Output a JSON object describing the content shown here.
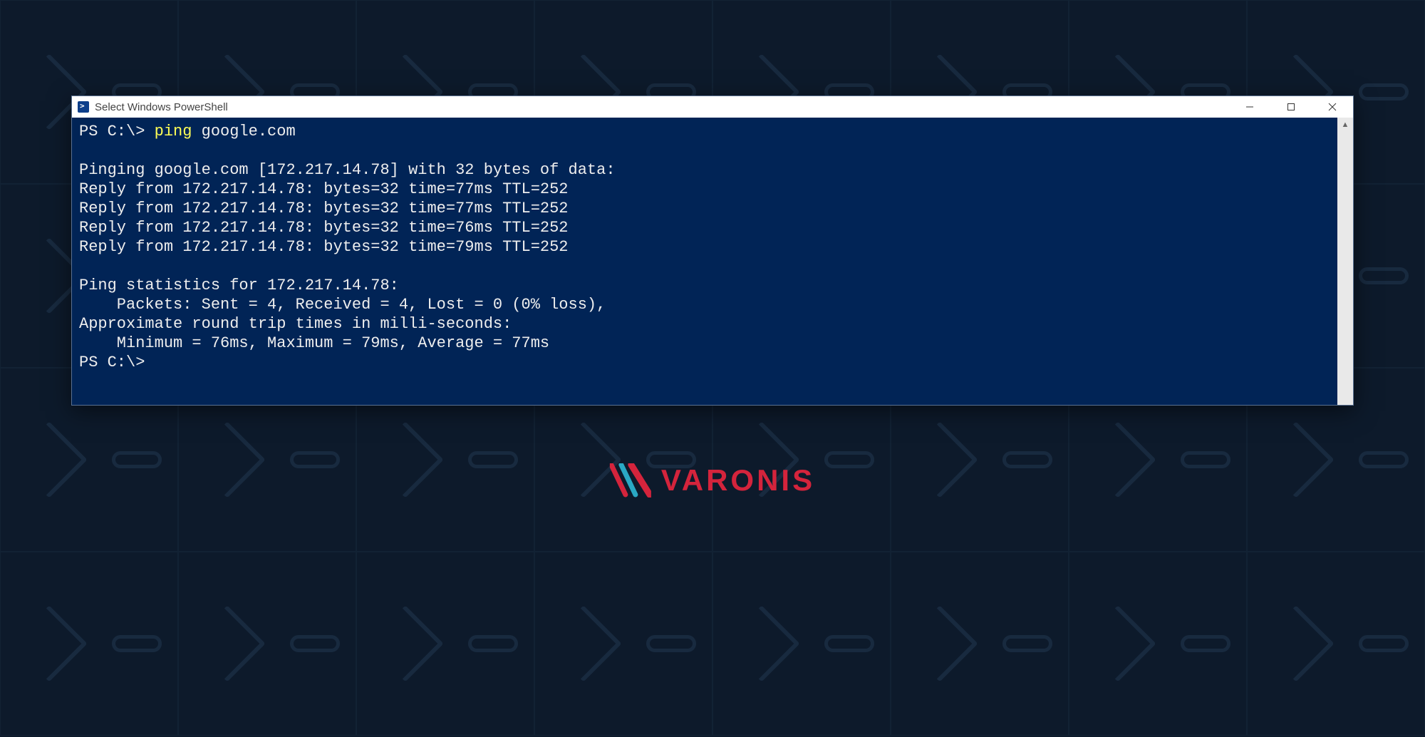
{
  "window": {
    "title": "Select Windows PowerShell"
  },
  "terminal": {
    "prompt1_prefix": "PS C:\\> ",
    "prompt1_cmd": "ping",
    "prompt1_args": " google.com",
    "blank1": "",
    "line_pinging": "Pinging google.com [172.217.14.78] with 32 bytes of data:",
    "reply1": "Reply from 172.217.14.78: bytes=32 time=77ms TTL=252",
    "reply2": "Reply from 172.217.14.78: bytes=32 time=77ms TTL=252",
    "reply3": "Reply from 172.217.14.78: bytes=32 time=76ms TTL=252",
    "reply4": "Reply from 172.217.14.78: bytes=32 time=79ms TTL=252",
    "blank2": "",
    "stats_header": "Ping statistics for 172.217.14.78:",
    "packets": "    Packets: Sent = 4, Received = 4, Lost = 0 (0% loss),",
    "rtt_header": "Approximate round trip times in milli-seconds:",
    "rtt_values": "    Minimum = 76ms, Maximum = 79ms, Average = 77ms",
    "prompt2": "PS C:\\>"
  },
  "logo": {
    "text": "VARONIS"
  }
}
